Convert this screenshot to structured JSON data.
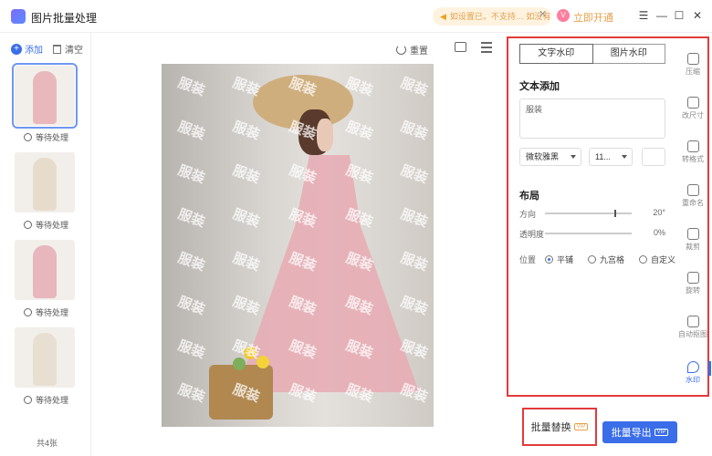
{
  "app": {
    "title": "图片批量处理",
    "notice": "如设置已，不支持… 如没有支持",
    "open_now": "立即开通",
    "vip_badge": "V"
  },
  "left": {
    "add_label": "添加",
    "clear_label": "清空",
    "thumbnails": [
      {
        "status": "等待处理",
        "color": "#e9b8bd"
      },
      {
        "status": "等待处理",
        "color": "#e7dccc"
      },
      {
        "status": "等待处理",
        "color": "#e8b6bd"
      },
      {
        "status": "等待处理",
        "color": "#e6dfd2"
      }
    ],
    "total": "共4张"
  },
  "preview_toolbar": {
    "reset_label": "重置"
  },
  "preview": {
    "watermark_text": "服装"
  },
  "settings": {
    "tabs": [
      {
        "label": "文字水印",
        "active": true
      },
      {
        "label": "图片水印",
        "active": false
      }
    ],
    "text_section_title": "文本添加",
    "text_value": "服装",
    "font_family": "微软雅黑",
    "font_size": "11...",
    "layout_section_title": "布局",
    "direction_label": "方向",
    "direction_value": "20°",
    "opacity_label": "透明度",
    "opacity_value": "0%",
    "position_label": "位置",
    "position_options": [
      {
        "label": "平铺",
        "checked": true
      },
      {
        "label": "九宫格",
        "checked": false
      },
      {
        "label": "自定义",
        "checked": false
      }
    ]
  },
  "side_tools": [
    {
      "label": "压缩",
      "icon": "image-icon",
      "active": false
    },
    {
      "label": "改尺寸",
      "icon": "resize-icon",
      "active": false
    },
    {
      "label": "转格式",
      "icon": "convert-icon",
      "active": false
    },
    {
      "label": "重命名",
      "icon": "rename-icon",
      "active": false
    },
    {
      "label": "裁剪",
      "icon": "crop-icon",
      "active": false
    },
    {
      "label": "旋转",
      "icon": "rotate-icon",
      "active": false
    },
    {
      "label": "自动抠图",
      "icon": "cutout-icon",
      "active": false
    },
    {
      "label": "水印",
      "icon": "watermark-icon",
      "active": true
    }
  ],
  "footer": {
    "replace_label": "批量替换",
    "export_label": "批量导出",
    "vip_tag": "VIP"
  },
  "colors": {
    "accent": "#3a6de8",
    "highlight_border": "#e23b3b",
    "vip_gold": "#e5a04a"
  }
}
